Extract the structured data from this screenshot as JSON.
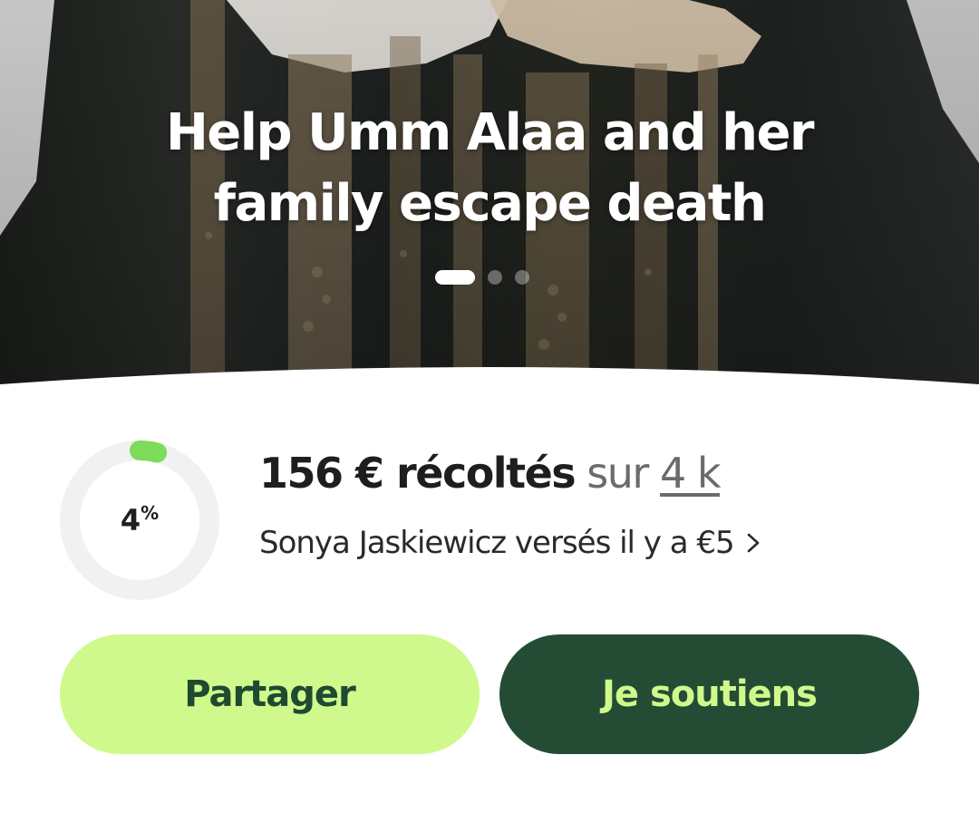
{
  "hero": {
    "title_line1": "Help Umm Alaa and her",
    "title_line2": "family escape death",
    "carousel": {
      "count": 3,
      "active_index": 0
    }
  },
  "progress": {
    "percent_value": "4",
    "percent_sign": "%",
    "fraction": 0.04,
    "ring_color": "#7ddb5a",
    "track_color": "#f1f1f1"
  },
  "funding": {
    "raised_label": "156 € récoltés",
    "sur_label": "sur",
    "goal_label": "4 k"
  },
  "donor": {
    "text": "Sonya Jaskiewicz versés il y a €5",
    "chevron_icon": "chevron-right-icon"
  },
  "buttons": {
    "share_label": "Partager",
    "support_label": "Je soutiens"
  },
  "colors": {
    "share_bg": "#cff98c",
    "share_text": "#1f4a31",
    "support_bg": "#244c35",
    "support_text": "#cff98c"
  }
}
